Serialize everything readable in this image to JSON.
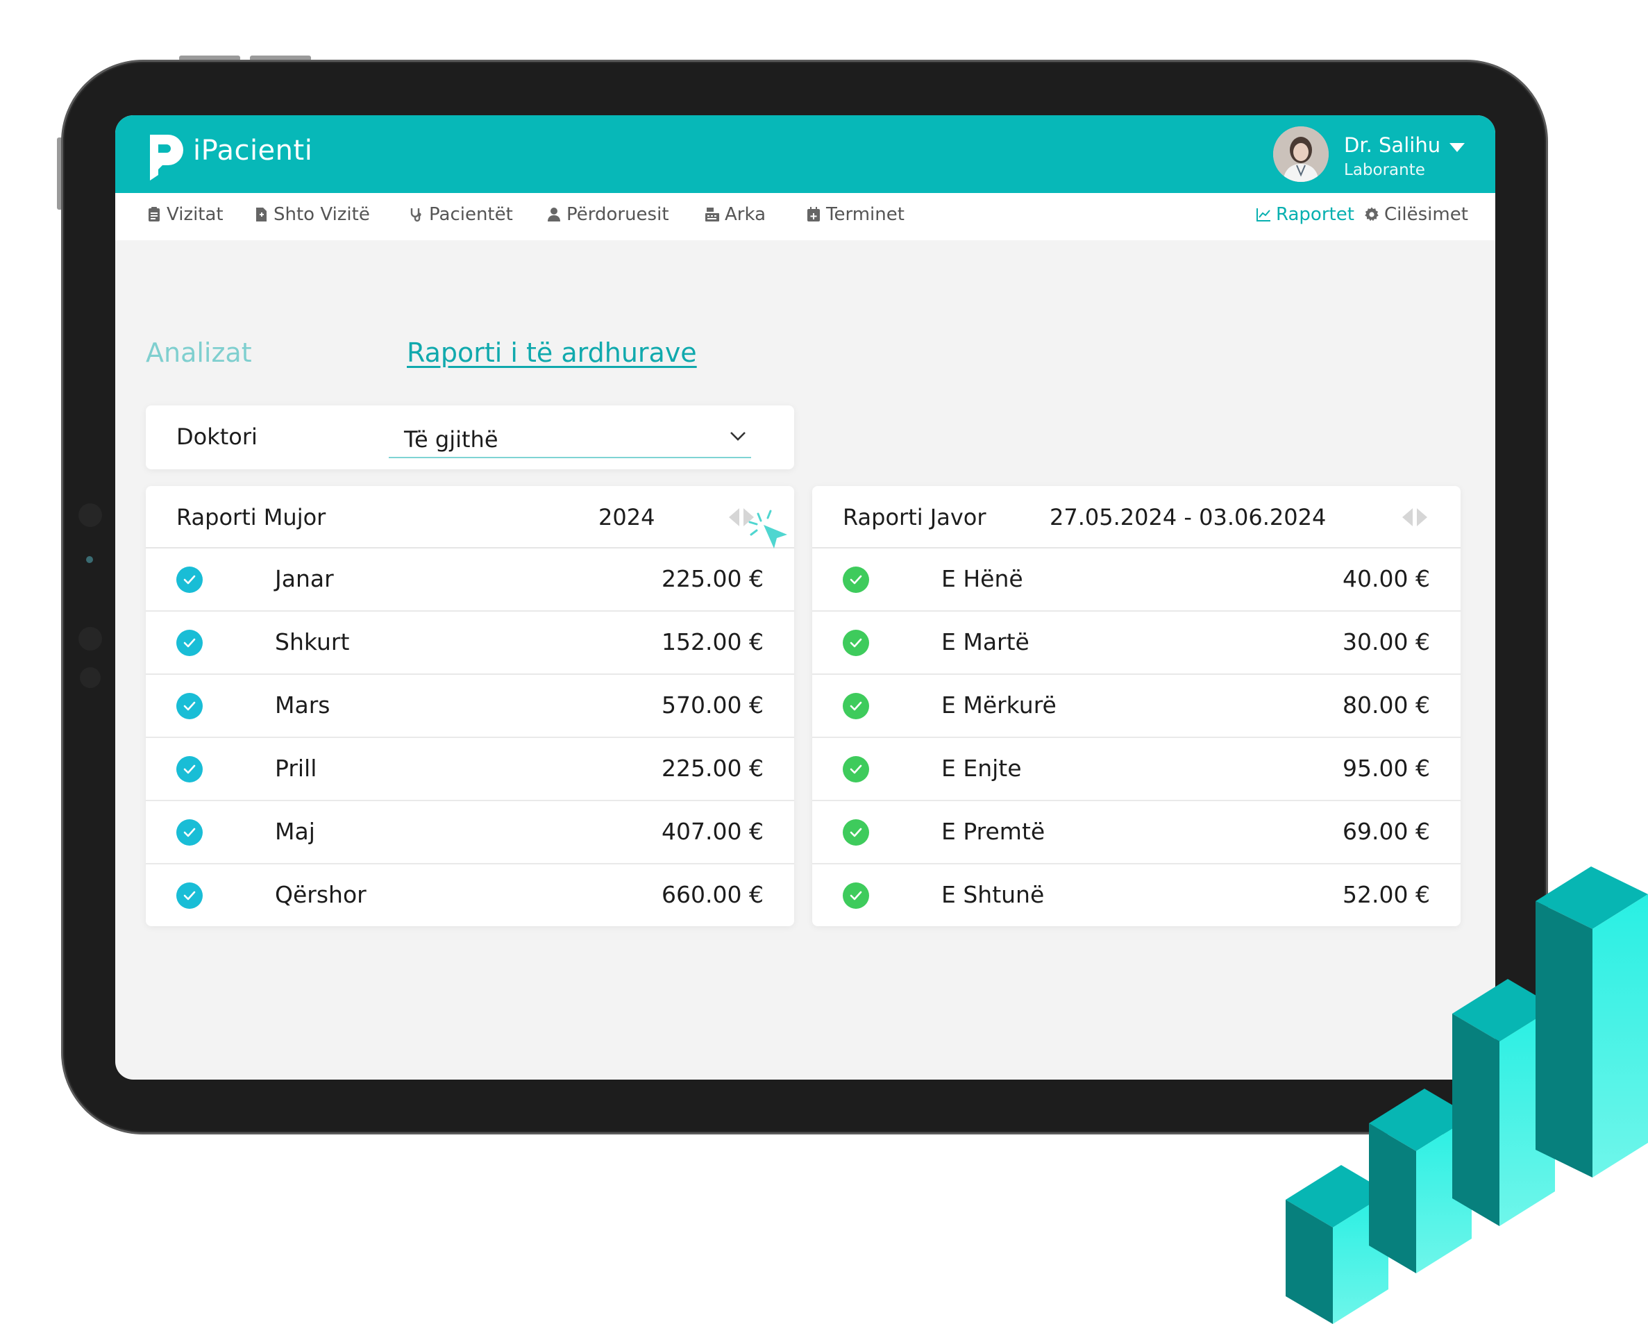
{
  "header": {
    "brand": "iPacienti",
    "user_name": "Dr. Salihu",
    "user_role": "Laborante"
  },
  "nav": {
    "items": [
      {
        "label": "Vizitat",
        "icon": "clipboard-icon"
      },
      {
        "label": "Shto Vizitë",
        "icon": "add-document-icon"
      },
      {
        "label": "Pacientët",
        "icon": "stethoscope-icon"
      },
      {
        "label": "Përdoruesit",
        "icon": "users-icon"
      },
      {
        "label": "Arka",
        "icon": "cash-register-icon"
      },
      {
        "label": "Terminet",
        "icon": "calendar-plus-icon"
      }
    ],
    "right_items": [
      {
        "label": "Raportet",
        "icon": "chart-line-icon",
        "active": true
      },
      {
        "label": "Cilësimet",
        "icon": "gear-icon",
        "active": false
      }
    ]
  },
  "tabs": {
    "analizat": "Analizat",
    "raporti": "Raporti i të ardhurave"
  },
  "filter": {
    "label": "Doktori",
    "selected": "Të gjithë"
  },
  "monthly": {
    "title": "Raporti Mujor",
    "period": "2024",
    "rows": [
      {
        "label": "Janar",
        "value": "225.00 €"
      },
      {
        "label": "Shkurt",
        "value": "152.00 €"
      },
      {
        "label": "Mars",
        "value": "570.00 €"
      },
      {
        "label": "Prill",
        "value": "225.00 €"
      },
      {
        "label": "Maj",
        "value": "407.00 €"
      },
      {
        "label": "Qërshor",
        "value": "660.00 €"
      }
    ]
  },
  "weekly": {
    "title": "Raporti Javor",
    "period": "27.05.2024 - 03.06.2024",
    "rows": [
      {
        "label": "E Hënë",
        "value": "40.00 €"
      },
      {
        "label": "E Martë",
        "value": "30.00 €"
      },
      {
        "label": "E Mërkurë",
        "value": "80.00 €"
      },
      {
        "label": "E Enjte",
        "value": "95.00 €"
      },
      {
        "label": "E Premtë",
        "value": "69.00 €"
      },
      {
        "label": "E Shtunë",
        "value": "52.00 €"
      }
    ]
  },
  "colors": {
    "brand": "#07b8b8",
    "check_monthly": "#19bdd6",
    "check_weekly": "#3ecb5c"
  }
}
